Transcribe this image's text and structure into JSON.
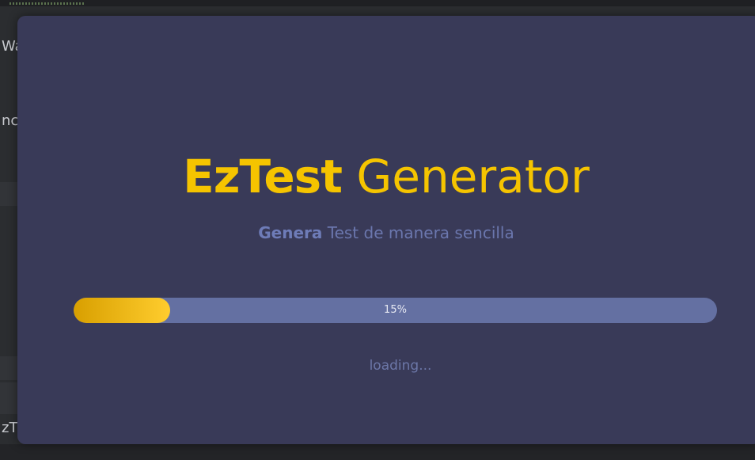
{
  "background": {
    "fragments": [
      "Wa",
      "nc",
      "zT"
    ]
  },
  "modal": {
    "title": {
      "brand": "EzTest",
      "rest": " Generator"
    },
    "subtitle": {
      "emphasis": "Genera",
      "rest": " Test de manera sencilla"
    },
    "progress": {
      "percent": 15,
      "label": "15%"
    },
    "status": "loading..."
  },
  "colors": {
    "accent": "#f5c400",
    "modal_bg": "#393a58",
    "track": "#6470a2",
    "fill_start": "#d89f00",
    "fill_end": "#ffcd2e"
  }
}
